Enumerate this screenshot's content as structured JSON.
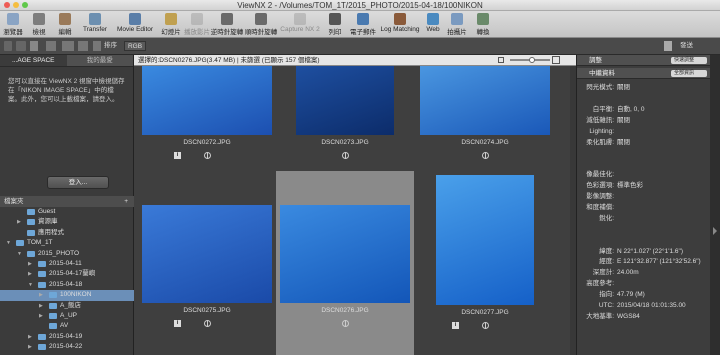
{
  "window": {
    "title": "ViewNX 2 - /Volumes/TOM_1T/2015_PHOTO/2015-04-18/100NIKON"
  },
  "toolbar": {
    "items": [
      {
        "label": "瀏覽器",
        "color": "#8aa4c4",
        "dim": false
      },
      {
        "label": "檢視",
        "color": "#7d7d7d",
        "dim": false
      },
      {
        "label": "編輯",
        "color": "#9a7a5a",
        "dim": false
      },
      {
        "label": "Transfer",
        "color": "#6c8fb0",
        "dim": false
      },
      {
        "label": "Movie Editor",
        "color": "#5a7ea8",
        "dim": false
      },
      {
        "label": "幻燈片",
        "color": "#c0a050",
        "dim": false
      },
      {
        "label": "播放影片",
        "color": "#9a9a9a",
        "dim": true
      },
      {
        "label": "逆時針旋轉",
        "color": "#6a6a6a",
        "dim": false
      },
      {
        "label": "順時針旋轉",
        "color": "#6a6a6a",
        "dim": false
      },
      {
        "label": "Capture NX 2",
        "color": "#9a9a9a",
        "dim": true
      },
      {
        "label": "列印",
        "color": "#555555",
        "dim": false
      },
      {
        "label": "電子郵件",
        "color": "#4a7ab0",
        "dim": false
      },
      {
        "label": "Log Matching",
        "color": "#8a5a3a",
        "dim": false
      },
      {
        "label": "Web",
        "color": "#4a8ac0",
        "dim": false
      },
      {
        "label": "拍攝片",
        "color": "#7a9ac0",
        "dim": false
      },
      {
        "label": "轉換",
        "color": "#6a8a6a",
        "dim": false
      }
    ]
  },
  "subbar": {
    "sort_label": "排序",
    "rgb_label": "RGB",
    "publish_label": "發送"
  },
  "left_panel": {
    "tabs": [
      {
        "label": "...AGE SPACE",
        "active": true
      },
      {
        "label": "我的最愛",
        "active": false
      }
    ],
    "info_text": "您可以直接在 ViewNX 2 視窗中檢視儲存在「NIKON IMAGE SPACE」中的檔案。此外，您可以上載檔案，請登入。",
    "login_button": "登入...",
    "folder_header": "檔案夾",
    "folder_add": "+",
    "tree": [
      {
        "label": "Guest",
        "indent": 1,
        "expander": "",
        "selected": false
      },
      {
        "label": "資源庫",
        "indent": 1,
        "expander": "▶",
        "selected": false
      },
      {
        "label": "應用程式",
        "indent": 1,
        "expander": "",
        "selected": false
      },
      {
        "label": "TOM_1T",
        "indent": 0,
        "expander": "▼",
        "selected": false
      },
      {
        "label": "2015_PHOTO",
        "indent": 1,
        "expander": "▼",
        "selected": false
      },
      {
        "label": "2015-04-11",
        "indent": 2,
        "expander": "▶",
        "selected": false
      },
      {
        "label": "2015-04-17蘭嶼",
        "indent": 2,
        "expander": "▶",
        "selected": false
      },
      {
        "label": "2015-04-18",
        "indent": 2,
        "expander": "▼",
        "selected": false
      },
      {
        "label": "100NIKON",
        "indent": 3,
        "expander": "▶",
        "selected": true
      },
      {
        "label": "A_飯店",
        "indent": 3,
        "expander": "▶",
        "selected": false
      },
      {
        "label": "A_UP",
        "indent": 3,
        "expander": "▶",
        "selected": false
      },
      {
        "label": "AV",
        "indent": 3,
        "expander": "",
        "selected": false
      },
      {
        "label": "2015-04-19",
        "indent": 2,
        "expander": "▶",
        "selected": false
      },
      {
        "label": "2015-04-22",
        "indent": 2,
        "expander": "▶",
        "selected": false
      }
    ]
  },
  "content": {
    "status_text": "選擇的:DSCN0276.JPG(3.47 MB) | 未篩選 (已顯示 157 個檔案)",
    "zoom_percent": 55,
    "thumbnails": [
      {
        "name": "DSCN0272.JPG",
        "row": 0,
        "col": 0,
        "selected": false,
        "info": true,
        "c1": "#1c4fb0",
        "c2": "#3a8ae0"
      },
      {
        "name": "DSCN0273.JPG",
        "row": 0,
        "col": 1,
        "selected": false,
        "info": false,
        "c1": "#0c2c6a",
        "c2": "#1e4fa0"
      },
      {
        "name": "DSCN0274.JPG",
        "row": 0,
        "col": 2,
        "selected": false,
        "info": false,
        "c1": "#1a58b8",
        "c2": "#4a96e0"
      },
      {
        "name": "DSCN0275.JPG",
        "row": 1,
        "col": 0,
        "selected": false,
        "info": true,
        "c1": "#1a4aa8",
        "c2": "#3a7ad8"
      },
      {
        "name": "DSCN0276.JPG",
        "row": 1,
        "col": 1,
        "selected": true,
        "info": false,
        "c1": "#1356b8",
        "c2": "#3a8ae0"
      },
      {
        "name": "DSCN0277.JPG",
        "row": 1,
        "col": 2,
        "selected": false,
        "info": true,
        "c1": "#1560c8",
        "c2": "#4aa0ea"
      }
    ]
  },
  "right_panel": {
    "header1": "調整",
    "header1_dropdown": "快速調整",
    "header2": "中繼資料",
    "header2_dropdown": "全部資訊",
    "rows": [
      {
        "k": "閃光模式:",
        "v": "關閉"
      },
      {
        "k": "",
        "v": ""
      },
      {
        "k": "白平衡:",
        "v": "自動, 0, 0"
      },
      {
        "k": "減低雜訊:",
        "v": "關閉"
      },
      {
        "k": "Lighting:",
        "v": ""
      },
      {
        "k": "柔化肌膚:",
        "v": "關閉"
      },
      {
        "k": "",
        "v": ""
      },
      {
        "k": "",
        "v": ""
      },
      {
        "k": "像最佳化:",
        "v": ""
      },
      {
        "k": "色彩選項:",
        "v": "標準色彩"
      },
      {
        "k": "影像調整:",
        "v": ""
      },
      {
        "k": "和度補償:",
        "v": ""
      },
      {
        "k": "銳化:",
        "v": ""
      },
      {
        "k": "",
        "v": ""
      },
      {
        "k": "",
        "v": ""
      },
      {
        "k": "緯度:",
        "v": "N 22°1.027' (22°1'1.6\")"
      },
      {
        "k": "經度:",
        "v": "E 121°32.877' (121°32'52.6\")"
      },
      {
        "k": "深度計:",
        "v": "24.00m"
      },
      {
        "k": "高度參考:",
        "v": ""
      },
      {
        "k": "指向:",
        "v": "47.79 (M)"
      },
      {
        "k": "UTC:",
        "v": "2015/04/18 01:01:35.00"
      },
      {
        "k": "大地基準:",
        "v": "WGS84"
      }
    ]
  }
}
